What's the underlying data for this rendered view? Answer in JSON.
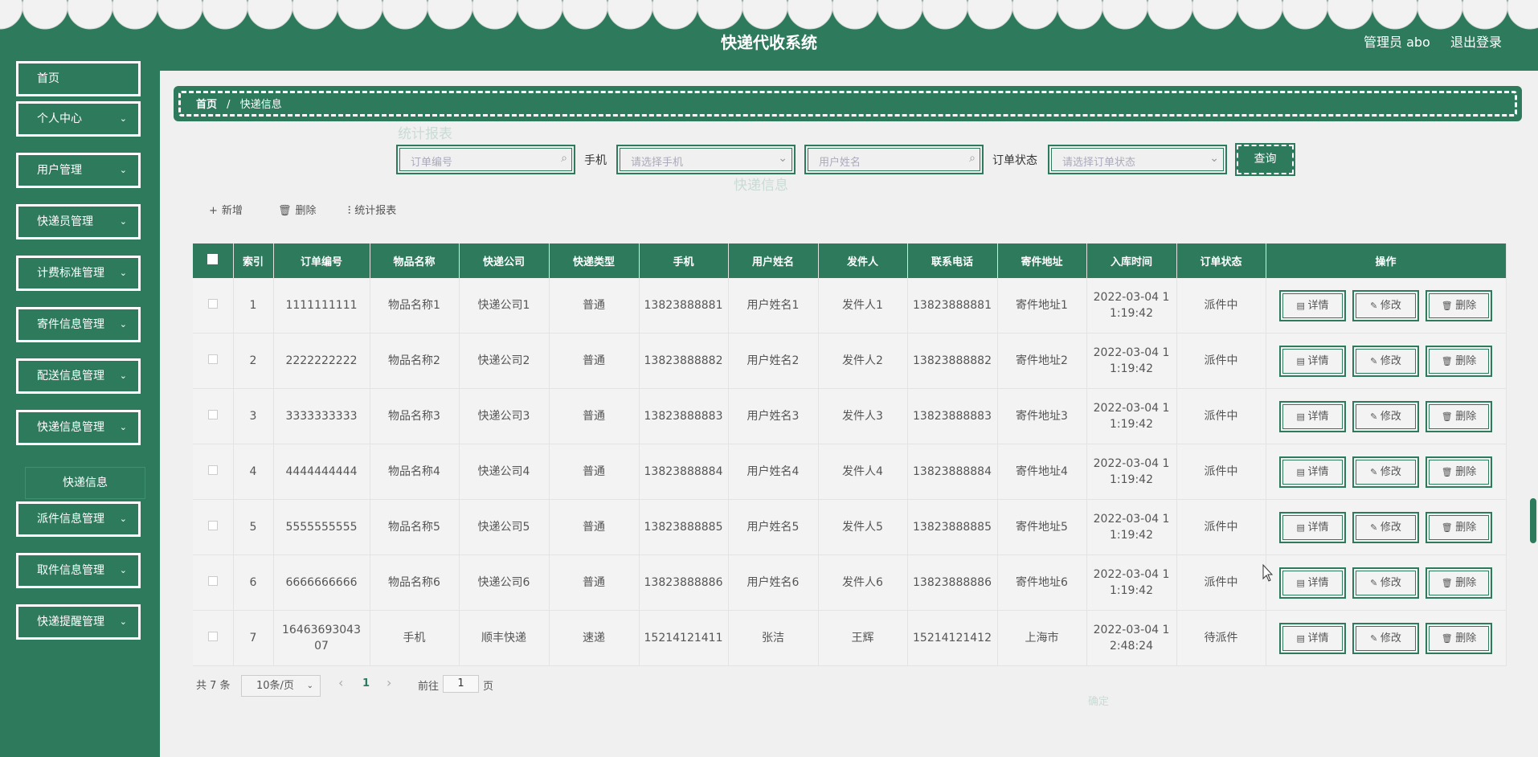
{
  "header": {
    "title": "快递代收系统",
    "admin": "管理员 abo",
    "logout": "退出登录"
  },
  "colors": {
    "brand": "#2e7a5d",
    "header_text": "#ffffff"
  },
  "sidebar": {
    "items": [
      {
        "label": "首页",
        "has_chevron": false
      },
      {
        "label": "个人中心",
        "has_chevron": true
      },
      {
        "label": "用户管理",
        "has_chevron": true
      },
      {
        "label": "快递员管理",
        "has_chevron": true
      },
      {
        "label": "计费标准管理",
        "has_chevron": true
      },
      {
        "label": "寄件信息管理",
        "has_chevron": true
      },
      {
        "label": "配送信息管理",
        "has_chevron": true
      },
      {
        "label": "快递信息管理",
        "has_chevron": true
      },
      {
        "label": "派件信息管理",
        "has_chevron": true
      },
      {
        "label": "取件信息管理",
        "has_chevron": true
      },
      {
        "label": "快递提醒管理",
        "has_chevron": true
      }
    ],
    "submenu": {
      "label": "快递信息"
    }
  },
  "breadcrumb": {
    "home": "首页",
    "sep": "/",
    "current": "快递信息"
  },
  "filters": {
    "order_no_placeholder": "订单编号",
    "phone_label": "手机",
    "phone_placeholder": "请选择手机",
    "username_placeholder": "用户姓名",
    "status_label": "订单状态",
    "status_placeholder": "请选择订单状态",
    "search": "查询"
  },
  "toolbar": {
    "add": "新增",
    "delete": "删除",
    "report": "统计报表"
  },
  "overlay": {
    "title": "统计报表",
    "chart_title": "快递信息",
    "confirm": "确定"
  },
  "table": {
    "headers": [
      "",
      "索引",
      "订单编号",
      "物品名称",
      "快递公司",
      "快递类型",
      "手机",
      "用户姓名",
      "发件人",
      "联系电话",
      "寄件地址",
      "入库时间",
      "订单状态",
      "操作"
    ],
    "rows": [
      [
        "1",
        "1111111111",
        "物品名称1",
        "快递公司1",
        "普通",
        "13823888881",
        "用户姓名1",
        "发件人1",
        "13823888881",
        "寄件地址1",
        "2022-03-04 1\n1:19:42",
        "派件中"
      ],
      [
        "2",
        "2222222222",
        "物品名称2",
        "快递公司2",
        "普通",
        "13823888882",
        "用户姓名2",
        "发件人2",
        "13823888882",
        "寄件地址2",
        "2022-03-04 1\n1:19:42",
        "派件中"
      ],
      [
        "3",
        "3333333333",
        "物品名称3",
        "快递公司3",
        "普通",
        "13823888883",
        "用户姓名3",
        "发件人3",
        "13823888883",
        "寄件地址3",
        "2022-03-04 1\n1:19:42",
        "派件中"
      ],
      [
        "4",
        "4444444444",
        "物品名称4",
        "快递公司4",
        "普通",
        "13823888884",
        "用户姓名4",
        "发件人4",
        "13823888884",
        "寄件地址4",
        "2022-03-04 1\n1:19:42",
        "派件中"
      ],
      [
        "5",
        "5555555555",
        "物品名称5",
        "快递公司5",
        "普通",
        "13823888885",
        "用户姓名5",
        "发件人5",
        "13823888885",
        "寄件地址5",
        "2022-03-04 1\n1:19:42",
        "派件中"
      ],
      [
        "6",
        "6666666666",
        "物品名称6",
        "快递公司6",
        "普通",
        "13823888886",
        "用户姓名6",
        "发件人6",
        "13823888886",
        "寄件地址6",
        "2022-03-04 1\n1:19:42",
        "派件中"
      ],
      [
        "7",
        "16463693043\n07",
        "手机",
        "顺丰快递",
        "速递",
        "15214121411",
        "张洁",
        "王辉",
        "15214121412",
        "上海市",
        "2022-03-04 1\n2:48:24",
        "待派件"
      ]
    ],
    "actions": {
      "detail": "详情",
      "edit": "修改",
      "delete": "删除"
    }
  },
  "pagination": {
    "total": "共 7 条",
    "page_size": "10条/页",
    "prev": "‹",
    "current": "1",
    "next": "›",
    "goto": "前往",
    "goto_value": "1",
    "page_unit": "页"
  }
}
